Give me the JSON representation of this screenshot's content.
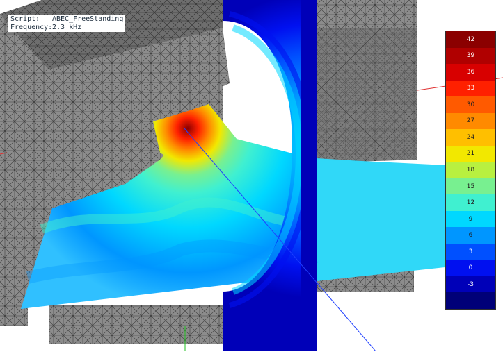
{
  "info": {
    "script_label": "Script:",
    "script_value": "ABEC_FreeStanding",
    "frequency_label": "Frequency:",
    "frequency_value": "2.3 kHz"
  },
  "colorbar": {
    "labels": [
      "42",
      "39",
      "36",
      "33",
      "30",
      "27",
      "24",
      "21",
      "18",
      "15",
      "12",
      "9",
      "6",
      "3",
      "0",
      "-3",
      ""
    ],
    "colors": [
      "#8b0000",
      "#b00000",
      "#d80000",
      "#ff2000",
      "#ff5a00",
      "#ff8a00",
      "#ffbf00",
      "#f2e800",
      "#b8f040",
      "#78f090",
      "#40f0d0",
      "#00d8ff",
      "#0096ff",
      "#0050ff",
      "#0010f0",
      "#0000b8",
      "#000078"
    ],
    "text_colors": [
      "#ffffff",
      "#ffffff",
      "#ffffff",
      "#ffffff",
      "#202020",
      "#202020",
      "#202020",
      "#202020",
      "#202020",
      "#202020",
      "#202020",
      "#202020",
      "#202020",
      "#ffffff",
      "#ffffff",
      "#ffffff",
      "#ffffff"
    ]
  },
  "colors": {
    "mesh_fill": "#8c8c8c",
    "mesh_line": "#3a3a3a",
    "axis_red": "#e03030",
    "axis_blue": "#2040ff",
    "axis_green": "#20c020"
  }
}
